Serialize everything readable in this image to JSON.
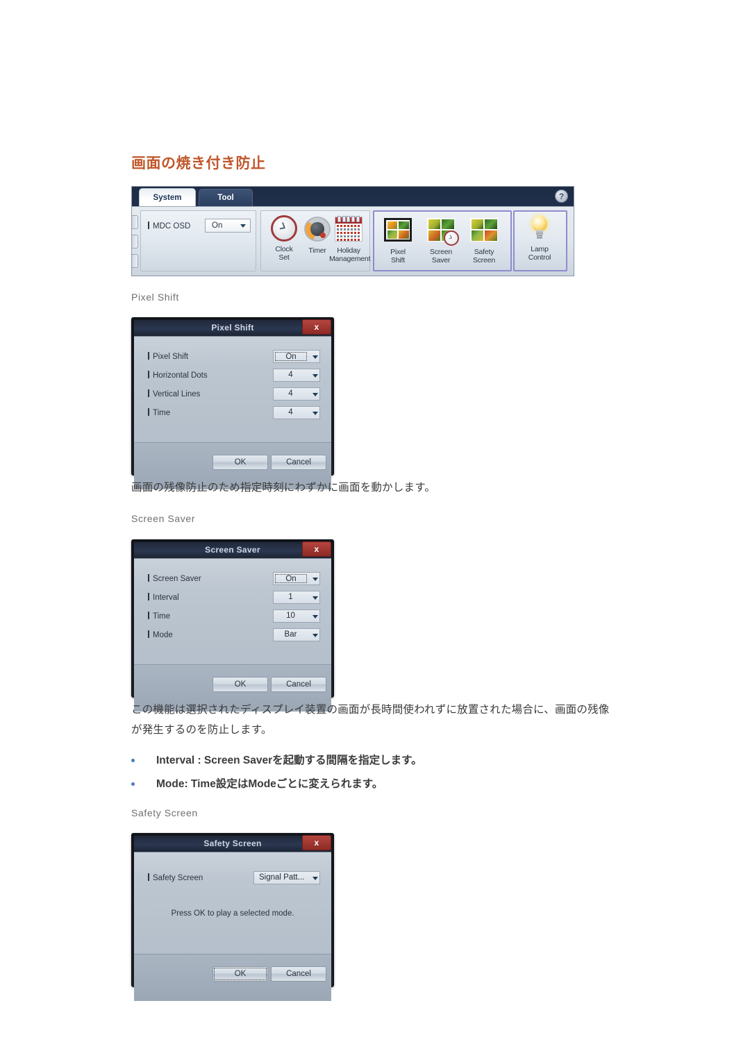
{
  "page": {
    "heading": "画面の焼き付き防止",
    "heading_color": "#c0562a",
    "bullet_color": "#4a7dbb"
  },
  "ribbon": {
    "tabs": [
      {
        "label": "System",
        "active": true
      },
      {
        "label": "Tool",
        "active": false
      }
    ],
    "help_label": "?",
    "osd": {
      "label": "MDC OSD",
      "value": "On"
    },
    "time_group": [
      {
        "icon": "clock-icon",
        "line1": "Clock",
        "line2": "Set"
      },
      {
        "icon": "timer-icon",
        "line1": "Timer",
        "line2": ""
      },
      {
        "icon": "calendar-icon",
        "line1": "Holiday",
        "line2": "Management"
      }
    ],
    "screen_group": [
      {
        "icon": "pixel-shift-icon",
        "line1": "Pixel",
        "line2": "Shift"
      },
      {
        "icon": "screen-saver-icon",
        "line1": "Screen",
        "line2": "Saver"
      },
      {
        "icon": "safety-screen-icon",
        "line1": "Safety",
        "line2": "Screen"
      }
    ],
    "lamp_group": [
      {
        "icon": "lamp-icon",
        "line1": "Lamp",
        "line2": "Control"
      }
    ]
  },
  "sections": {
    "pixel_shift": {
      "label": "Pixel Shift",
      "dialog": {
        "title": "Pixel Shift",
        "close_label": "x",
        "rows": [
          {
            "label": "Pixel Shift",
            "value": "On",
            "focused": true
          },
          {
            "label": "Horizontal Dots",
            "value": "4",
            "focused": false
          },
          {
            "label": "Vertical Lines",
            "value": "4",
            "focused": false
          },
          {
            "label": "Time",
            "value": "4",
            "focused": false
          }
        ],
        "ok_label": "OK",
        "cancel_label": "Cancel",
        "ok_focused": false
      },
      "description": "画面の残像防止のため指定時刻にわずかに画面を動かします。"
    },
    "screen_saver": {
      "label": "Screen Saver",
      "dialog": {
        "title": "Screen Saver",
        "close_label": "x",
        "rows": [
          {
            "label": "Screen Saver",
            "value": "On",
            "focused": true
          },
          {
            "label": "Interval",
            "value": "1",
            "focused": false
          },
          {
            "label": "Time",
            "value": "10",
            "focused": false
          },
          {
            "label": "Mode",
            "value": "Bar",
            "focused": false
          }
        ],
        "ok_label": "OK",
        "cancel_label": "Cancel",
        "ok_focused": false
      },
      "description_line1": "この機能は選択されたディスプレイ装置の画面が長時間使われずに放置された場合に、画面の残像",
      "description_line2": "が発生するのを防止します。",
      "bullets": [
        "Interval : Screen Saverを起動する間隔を指定します。",
        "Mode: Time設定はModeごとに変えられます。"
      ]
    },
    "safety_screen": {
      "label": "Safety Screen",
      "dialog": {
        "title": "Safety Screen",
        "close_label": "x",
        "rows": [
          {
            "label": "Safety Screen",
            "value": "Signal Patt...",
            "focused": false
          }
        ],
        "note": "Press OK to play a selected mode.",
        "ok_label": "OK",
        "cancel_label": "Cancel",
        "ok_focused": true
      }
    }
  }
}
